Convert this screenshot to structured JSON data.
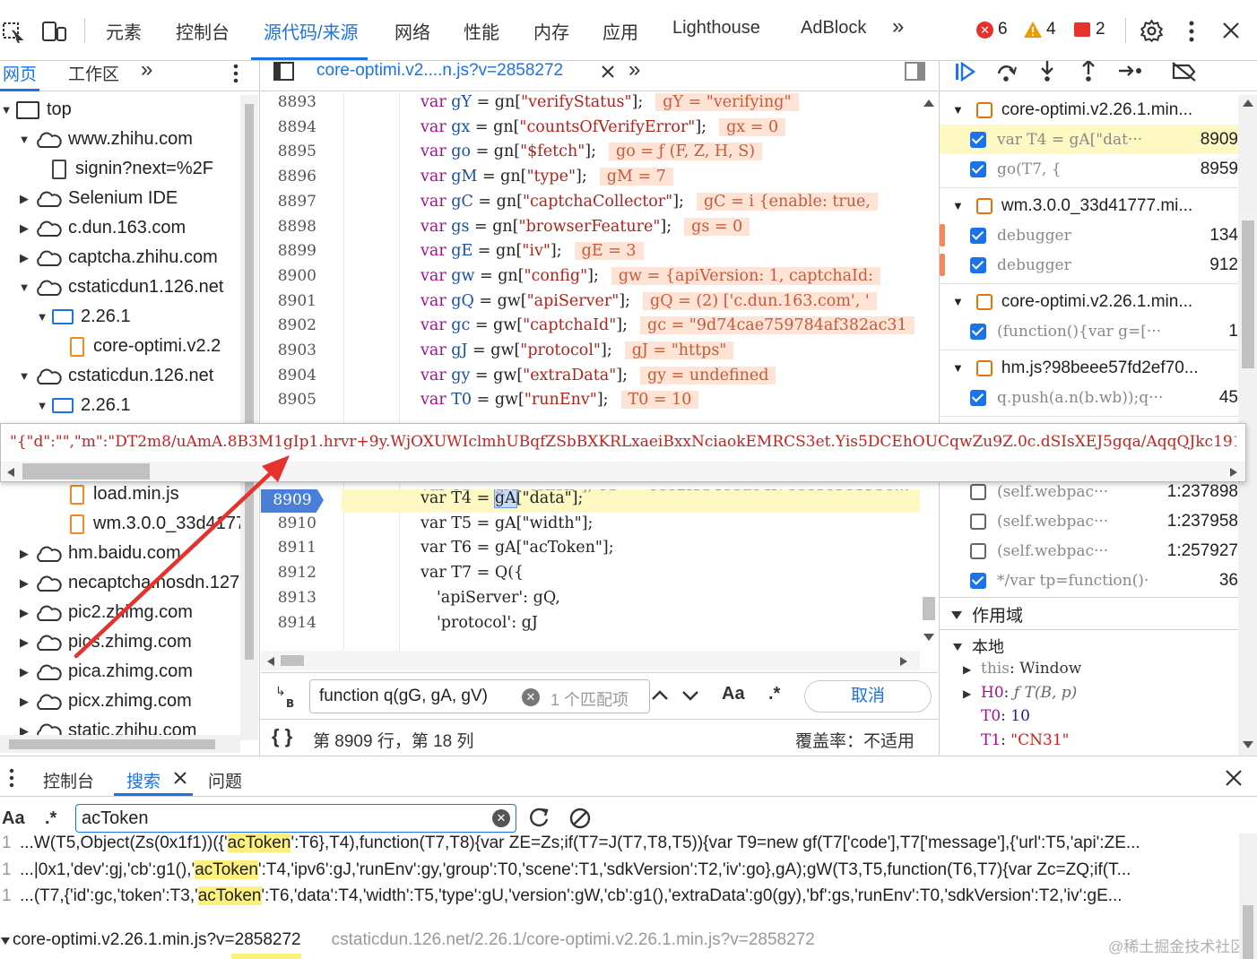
{
  "toolbar": {
    "tabs": [
      "元素",
      "控制台",
      "源代码/来源",
      "网络",
      "性能",
      "内存",
      "应用",
      "Lighthouse",
      "AdBlock"
    ],
    "more": "»",
    "errors": "6",
    "warnings": "4",
    "issues": "2"
  },
  "navigator": {
    "tabs": [
      "网页",
      "工作区"
    ],
    "more": "»",
    "tree": [
      {
        "label": "top",
        "depth": 0,
        "icon": "frame-icon",
        "expanded": true
      },
      {
        "label": "www.zhihu.com",
        "depth": 1,
        "icon": "cloud-icon",
        "expanded": true
      },
      {
        "label": "signin?next=%2F",
        "depth": 2,
        "icon": "file-icon",
        "expanded": null
      },
      {
        "label": "Selenium IDE",
        "depth": 1,
        "icon": "cloud-icon",
        "expanded": false
      },
      {
        "label": "c.dun.163.com",
        "depth": 1,
        "icon": "cloud-icon",
        "expanded": false
      },
      {
        "label": "captcha.zhihu.com",
        "depth": 1,
        "icon": "cloud-icon",
        "expanded": false
      },
      {
        "label": "cstaticdun1.126.net",
        "depth": 1,
        "icon": "cloud-icon",
        "expanded": true
      },
      {
        "label": "2.26.1",
        "depth": 2,
        "icon": "folder-icon",
        "expanded": true
      },
      {
        "label": "core-optimi.v2.2",
        "depth": 3,
        "icon": "js-file-icon",
        "expanded": null
      },
      {
        "label": "cstaticdun.126.net",
        "depth": 1,
        "icon": "cloud-icon",
        "expanded": true
      },
      {
        "label": "2.26.1",
        "depth": 2,
        "icon": "folder-icon",
        "expanded": true
      }
    ],
    "tree_below": [
      {
        "label": "load.min.js",
        "depth": 3,
        "icon": "js-file-icon",
        "expanded": null
      },
      {
        "label": "wm.3.0.0_33d4177",
        "depth": 3,
        "icon": "js-file-icon",
        "expanded": null
      },
      {
        "label": "hm.baidu.com",
        "depth": 1,
        "icon": "cloud-icon",
        "expanded": false
      },
      {
        "label": "necaptcha.nosdn.127",
        "depth": 1,
        "icon": "cloud-icon",
        "expanded": false
      },
      {
        "label": "pic2.zhimg.com",
        "depth": 1,
        "icon": "cloud-icon",
        "expanded": false
      },
      {
        "label": "pics.zhimg.com",
        "depth": 1,
        "icon": "cloud-icon",
        "expanded": false
      },
      {
        "label": "pica.zhimg.com",
        "depth": 1,
        "icon": "cloud-icon",
        "expanded": false
      },
      {
        "label": "picx.zhimg.com",
        "depth": 1,
        "icon": "cloud-icon",
        "expanded": false
      },
      {
        "label": "static.zhihu.com",
        "depth": 1,
        "icon": "cloud-icon",
        "expanded": false
      }
    ]
  },
  "editor": {
    "file_tab": "core-optimi.v2....n.js?v=2858272",
    "lines_top": [
      {
        "num": "8893",
        "name": "gY",
        "key": "verifyStatus",
        "src": "gn",
        "inline": "gY = \"verifying\""
      },
      {
        "num": "8894",
        "name": "gx",
        "key": "countsOfVerifyError",
        "src": "gn",
        "inline": "gx = 0"
      },
      {
        "num": "8895",
        "name": "go",
        "key": "$fetch",
        "src": "gn",
        "inline": "go = ƒ (F, Z, H, S)"
      },
      {
        "num": "8896",
        "name": "gM",
        "key": "type",
        "src": "gn",
        "inline": "gM = 7"
      },
      {
        "num": "8897",
        "name": "gC",
        "key": "captchaCollector",
        "src": "gn",
        "inline": "gC = i {enable: true,"
      },
      {
        "num": "8898",
        "name": "gs",
        "key": "browserFeature",
        "src": "gn",
        "inline": "gs = 0"
      },
      {
        "num": "8899",
        "name": "gE",
        "key": "iv",
        "src": "gn",
        "inline": "gE = 3"
      },
      {
        "num": "8900",
        "name": "gw",
        "key": "config",
        "src": "gn",
        "inline": "gw = {apiVersion: 1, captchaId:"
      },
      {
        "num": "8901",
        "name": "gQ",
        "key": "apiServer",
        "src": "gw",
        "inline": "gQ = (2) ['c.dun.163.com', '"
      },
      {
        "num": "8902",
        "name": "gc",
        "key": "captchaId",
        "src": "gw",
        "inline": "gc = \"9d74cae759784af382ac31"
      },
      {
        "num": "8903",
        "name": "gJ",
        "key": "protocol",
        "src": "gw",
        "inline": "gJ = \"https\""
      },
      {
        "num": "8904",
        "name": "gy",
        "key": "extraData",
        "src": "gw",
        "inline": "gy = undefined"
      },
      {
        "num": "8905",
        "name": "T0",
        "key": "runEnv",
        "src": "gw",
        "inline": "T0 = 10"
      }
    ],
    "lines_bottom": [
      {
        "num": "8909",
        "code_a": "var T4 = ",
        "code_sel": "gA",
        "code_b": "[\"data\"];",
        "current": true
      },
      {
        "num": "8910",
        "code_a": "var T5 = gA[\"width\"];",
        "code_sel": "",
        "code_b": "",
        "current": false
      },
      {
        "num": "8911",
        "code_a": "var T6 = gA[\"acToken\"];",
        "code_sel": "",
        "code_b": "",
        "current": false
      },
      {
        "num": "8912",
        "code_a": "var T7 = Q({",
        "code_sel": "",
        "code_b": "",
        "current": false
      },
      {
        "num": "8913",
        "code_a": "'apiServer': gQ,",
        "code_sel": "",
        "code_b": "",
        "current": false
      },
      {
        "num": "8914",
        "code_a": "'protocol': gJ",
        "code_sel": "",
        "code_b": "",
        "current": false
      }
    ],
    "tooltip": "\"{\"d\":\"\",\"m\":\"DT2m8/uAmA.8B3M1gIp1.hrvr+9y.WjOXUWIclmhUBqfZSbBXKRLxaeiBxxNciaokEMRCS3et.Yis5DCEhOUCqwZu9Z.0c.dSIsXEJ5gqa/AqqQJkc1915VF.ds0v",
    "search": {
      "value": "function q(gG, gA, gV)",
      "matches": "1 个匹配项",
      "case_label": "Aa",
      "regex_label": ".*",
      "cancel": "取消"
    },
    "status": {
      "position": "第 8909 行，第 18 列",
      "coverage": "覆盖率：不适用"
    }
  },
  "breakpoints": {
    "groups": [
      {
        "file": "core-optimi.v2.26.1.min...",
        "items": [
          {
            "code": "var T4 = gA[\"dat···",
            "line": "8909",
            "checked": true,
            "highlight": true
          },
          {
            "code": "go(T7, {",
            "line": "8959",
            "checked": true,
            "highlight": false
          }
        ]
      },
      {
        "file": "wm.3.0.0_33d41777.mi...",
        "items": [
          {
            "code": "debugger",
            "line": "134",
            "checked": true,
            "highlight": false
          },
          {
            "code": "debugger",
            "line": "912",
            "checked": true,
            "highlight": false
          }
        ]
      },
      {
        "file": "core-optimi.v2.26.1.min...",
        "items": [
          {
            "code": "(function(){var g=[···",
            "line": "1",
            "checked": true,
            "highlight": false
          }
        ]
      },
      {
        "file": "hm.js?98beee57fd2ef70...",
        "items": [
          {
            "code": "q.push(a.n(b.wb));q···",
            "line": "45",
            "checked": true,
            "highlight": false
          }
        ]
      }
    ],
    "more_items": [
      {
        "code": "(self.webpac···",
        "line": "1:237898",
        "checked": false
      },
      {
        "code": "(self.webpac···",
        "line": "1:237958",
        "checked": false
      },
      {
        "code": "(self.webpac···",
        "line": "1:257927",
        "checked": false
      },
      {
        "code": "*/var tp=function()···",
        "line": "36",
        "checked": true
      }
    ],
    "scope_title": "作用域",
    "local_title": "本地",
    "scope_vars": [
      {
        "key": "this",
        "val": "Window",
        "expand": true
      },
      {
        "key": "H0",
        "val": "ƒ T(B, p)",
        "expand": true
      },
      {
        "key": "T0",
        "val": "10",
        "expand": false
      },
      {
        "key": "T1",
        "val": "\"CN31\"",
        "expand": false
      }
    ]
  },
  "drawer": {
    "tabs": [
      "控制台",
      "搜索",
      "问题"
    ],
    "search_value": "acToken",
    "case_label": "Aa",
    "regex_label": ".*",
    "results": [
      {
        "num": "1",
        "pre": "...W(T5,Object(Zs(0x1f1))({'",
        "hit": "acToken",
        "post": "':T6},T4),function(T7,T8){var ZE=Zs;if(T7=J(T7,T8,T5)){var T9=new gf(T7['code'],T7['message'],{'url':T5,'api':ZE..."
      },
      {
        "num": "1",
        "pre": "...|0x1,'dev':gj,'cb':g1(),'",
        "hit": "acToken",
        "post": "':T4,'ipv6':gJ,'runEnv':gy,'group':T0,'scene':T1,'sdkVersion':T2,'iv':go},gA);gW(T3,T5,function(T6,T7){var Zc=ZQ;if(T..."
      },
      {
        "num": "1",
        "pre": "...(T7,{'id':gc,'token':T3,'",
        "hit": "acToken",
        "post": "':T6,'data':T4,'width':T5,'type':gU,'version':gW,'cb':g1(),'extraData':g0(gy),'bf':gs,'runEnv':T0,'sdkVersion':T2,'iv':gE..."
      }
    ],
    "file_result": "core-optimi.v2.26.1.min.js?v=2858272",
    "file_path": "cstaticdun.126.net/2.26.1/core-optimi.v2.26.1.min.js?v=2858272",
    "watermark": "@稀土掘金技术社区"
  },
  "colors": {
    "accent": "#1a73e8",
    "highlight": "#fef9c3",
    "arrow": "#e5322d"
  }
}
